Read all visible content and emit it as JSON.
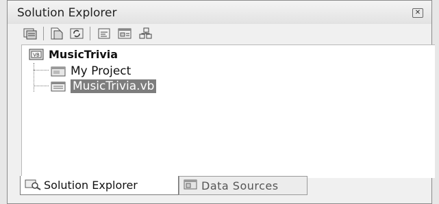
{
  "panel": {
    "title": "Solution Explorer",
    "close_icon": "close-icon"
  },
  "toolbar": {
    "buttons": [
      {
        "name": "properties-icon"
      },
      {
        "name": "show-all-files-icon"
      },
      {
        "name": "refresh-icon"
      },
      {
        "name": "view-code-icon"
      },
      {
        "name": "view-designer-icon"
      },
      {
        "name": "class-diagram-icon"
      }
    ]
  },
  "tree": {
    "root": {
      "label": "MusicTrivia",
      "icon": "vb-project-icon"
    },
    "children": [
      {
        "label": "My Project",
        "icon": "my-project-icon"
      },
      {
        "label": "MusicTrivia.vb",
        "icon": "form-icon",
        "selected": true
      }
    ]
  },
  "tabs": [
    {
      "label": "Solution Explorer",
      "icon": "solution-explorer-icon",
      "active": true
    },
    {
      "label": "Data Sources",
      "icon": "data-sources-icon",
      "active": false
    }
  ],
  "colors": {
    "selection": "#7d7d7d",
    "panel_bg": "#f0f0f0",
    "tree_bg": "#ffffff"
  }
}
